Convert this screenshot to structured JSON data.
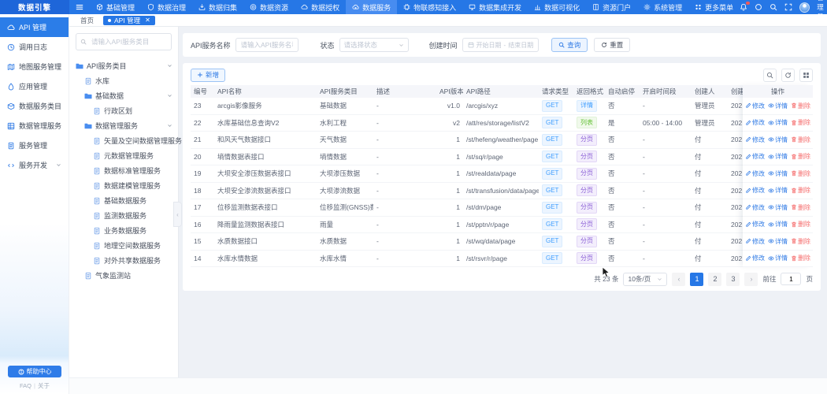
{
  "colors": {
    "primary": "#2677e6",
    "tag_blue": "#409eff",
    "tag_green": "#67c23a",
    "tag_purple": "#8b5fd6",
    "danger": "#f56c6c"
  },
  "topbar": {
    "logo": "数据引擎",
    "menu": [
      {
        "label": "基础管理",
        "icon": "cube"
      },
      {
        "label": "数据治理",
        "icon": "shield"
      },
      {
        "label": "数据归集",
        "icon": "collect"
      },
      {
        "label": "数据资源",
        "icon": "target"
      },
      {
        "label": "数据授权",
        "icon": "cloud"
      },
      {
        "label": "数据服务",
        "icon": "cloud-gear",
        "active": true
      },
      {
        "label": "物联感知接入",
        "icon": "chip"
      },
      {
        "label": "数据集成开发",
        "icon": "monitor"
      },
      {
        "label": "数据可视化",
        "icon": "chart"
      },
      {
        "label": "资源门户",
        "icon": "portal"
      },
      {
        "label": "系统管理",
        "icon": "gear"
      },
      {
        "label": "更多菜单",
        "icon": "more"
      }
    ],
    "user": "管理员"
  },
  "sidebar": {
    "items": [
      {
        "label": "API 管理",
        "icon": "cloud-api",
        "active": true
      },
      {
        "label": "调用日志",
        "icon": "log"
      },
      {
        "label": "地图服务管理",
        "icon": "map"
      },
      {
        "label": "应用管理",
        "icon": "app"
      },
      {
        "label": "数据服务类目",
        "icon": "category"
      },
      {
        "label": "数据管理服务",
        "icon": "data-grid"
      },
      {
        "label": "服务管理",
        "icon": "service"
      },
      {
        "label": "服务开发",
        "icon": "dev",
        "expandable": true
      }
    ],
    "help_label": "帮助中心",
    "links": [
      "FAQ",
      "关于"
    ]
  },
  "tabs": [
    {
      "label": "首页",
      "active": false
    },
    {
      "label": "API 管理",
      "active": true,
      "closable": true
    }
  ],
  "tree": {
    "search_placeholder": "请输入API服务类目",
    "items": [
      {
        "label": "API服务类目",
        "level": 0,
        "type": "folder",
        "expanded": true
      },
      {
        "label": "水库",
        "level": 1,
        "type": "leaf"
      },
      {
        "label": "基础数据",
        "level": 1,
        "type": "folder",
        "expanded": true
      },
      {
        "label": "行政区划",
        "level": 2,
        "type": "leaf"
      },
      {
        "label": "数据管理服务",
        "level": 1,
        "type": "folder",
        "expanded": true
      },
      {
        "label": "矢量及空间数据管理服务",
        "level": 2,
        "type": "leaf"
      },
      {
        "label": "元数据管理服务",
        "level": 2,
        "type": "leaf"
      },
      {
        "label": "数据标准管理服务",
        "level": 2,
        "type": "leaf"
      },
      {
        "label": "数据建模管理服务",
        "level": 2,
        "type": "leaf"
      },
      {
        "label": "基础数据服务",
        "level": 2,
        "type": "leaf"
      },
      {
        "label": "监测数据服务",
        "level": 2,
        "type": "leaf"
      },
      {
        "label": "业务数据服务",
        "level": 2,
        "type": "leaf"
      },
      {
        "label": "地理空间数据服务",
        "level": 2,
        "type": "leaf"
      },
      {
        "label": "对外共享数据服务",
        "level": 2,
        "type": "leaf"
      },
      {
        "label": "气象监测站",
        "level": 1,
        "type": "leaf"
      }
    ]
  },
  "filters": {
    "name_label": "API服务名称",
    "name_placeholder": "请输入API服务名称",
    "status_label": "状态",
    "status_placeholder": "请选择状态",
    "date_label": "创建时间",
    "date_start": "开始日期",
    "date_separator": "-",
    "date_end": "结束日期",
    "search_label": "查询",
    "reset_label": "重置"
  },
  "toolbar": {
    "add_label": "新增"
  },
  "table": {
    "columns": [
      "编号",
      "API名称",
      "API服务类目",
      "描述",
      "API版本",
      "API路径",
      "请求类型",
      "返回格式",
      "自动启停",
      "开启时间段",
      "创建人",
      "创建时间",
      "操作"
    ],
    "ops": {
      "edit": "修改",
      "detail": "详情",
      "delete": "删除"
    },
    "rows": [
      {
        "no": "23",
        "name": "arcgis影像服务",
        "category": "基础数据",
        "desc": "-",
        "version": "v1.0",
        "path": "/arcgis/xyz",
        "method": "GET",
        "format": "详情",
        "format_color": "blue",
        "auto": "否",
        "period": "-",
        "creator": "管理员",
        "created": "202"
      },
      {
        "no": "22",
        "name": "水库基础信息查询V2",
        "category": "水利工程",
        "desc": "-",
        "version": "v2",
        "path": "/att/res/storage/listV2",
        "method": "GET",
        "format": "列表",
        "format_color": "green",
        "auto": "是",
        "period": "05:00 - 14:00",
        "creator": "管理员",
        "created": "202"
      },
      {
        "no": "21",
        "name": "和风天气数据接口",
        "category": "天气数据",
        "desc": "-",
        "version": "1",
        "path": "/st/hefeng/weather/page",
        "method": "GET",
        "format": "分页",
        "format_color": "purple",
        "auto": "否",
        "period": "-",
        "creator": "付",
        "created": "202"
      },
      {
        "no": "20",
        "name": "墒情数据表接口",
        "category": "墒情数据",
        "desc": "-",
        "version": "1",
        "path": "/st/sq/r/page",
        "method": "GET",
        "format": "分页",
        "format_color": "purple",
        "auto": "否",
        "period": "-",
        "creator": "付",
        "created": "202"
      },
      {
        "no": "19",
        "name": "大坝安全渗压数据表接口",
        "category": "大坝渗压数据",
        "desc": "-",
        "version": "1",
        "path": "/st/realdata/page",
        "method": "GET",
        "format": "分页",
        "format_color": "purple",
        "auto": "否",
        "period": "-",
        "creator": "付",
        "created": "202"
      },
      {
        "no": "18",
        "name": "大坝安全渗流数据表接口",
        "category": "大坝渗流数据",
        "desc": "-",
        "version": "1",
        "path": "/st/transfusion/data/page",
        "method": "GET",
        "format": "分页",
        "format_color": "purple",
        "auto": "否",
        "period": "-",
        "creator": "付",
        "created": "202"
      },
      {
        "no": "17",
        "name": "位移监测数据表接口",
        "category": "位移监测(GNSS)数据",
        "desc": "-",
        "version": "1",
        "path": "/st/dm/page",
        "method": "GET",
        "format": "分页",
        "format_color": "purple",
        "auto": "否",
        "period": "-",
        "creator": "付",
        "created": "202"
      },
      {
        "no": "16",
        "name": "降雨量监测数据表接口",
        "category": "雨量",
        "desc": "-",
        "version": "1",
        "path": "/st/pptn/r/page",
        "method": "GET",
        "format": "分页",
        "format_color": "purple",
        "auto": "否",
        "period": "-",
        "creator": "付",
        "created": "202"
      },
      {
        "no": "15",
        "name": "水质数据接口",
        "category": "水质数据",
        "desc": "-",
        "version": "1",
        "path": "/st/wq/data/page",
        "method": "GET",
        "format": "分页",
        "format_color": "purple",
        "auto": "否",
        "period": "-",
        "creator": "付",
        "created": "202"
      },
      {
        "no": "14",
        "name": "水库水情数据",
        "category": "水库水情",
        "desc": "-",
        "version": "1",
        "path": "/st/rsvr/r/page",
        "method": "GET",
        "format": "分页",
        "format_color": "purple",
        "auto": "否",
        "period": "-",
        "creator": "付",
        "created": "202"
      }
    ]
  },
  "pagination": {
    "total": "共 23 条",
    "page_size": "10条/页",
    "pages": [
      "1",
      "2",
      "3"
    ],
    "current": "1",
    "jump_label": "前往",
    "jump_value": "1",
    "jump_unit": "页"
  }
}
